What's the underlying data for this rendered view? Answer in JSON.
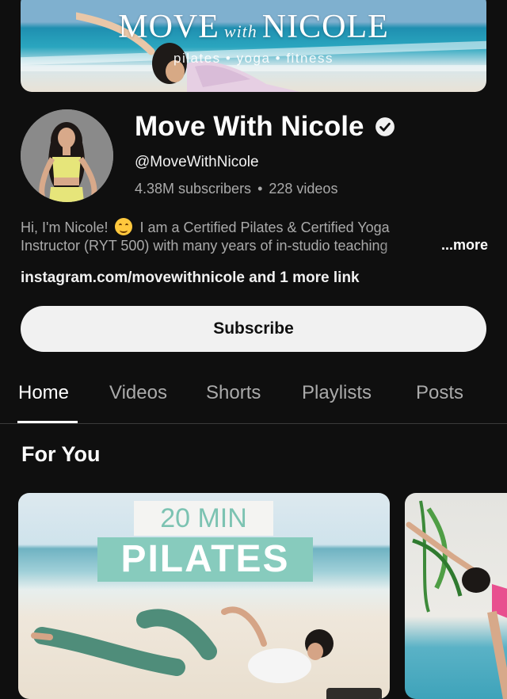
{
  "banner": {
    "title_left": "MOVE",
    "title_with": "with",
    "title_right": "NICOLE",
    "subtitle": "pilates • yoga • fitness"
  },
  "channel": {
    "name": "Move With Nicole",
    "handle": "@MoveWithNicole",
    "subscribers": "4.38M subscribers",
    "separator": "•",
    "videos": "228 videos",
    "description_line1_a": "Hi, I'm Nicole!",
    "description_line1_b": "I am a Certified Pilates & Certified Yoga",
    "description_line2": "Instructor (RYT 500) with many years of in-studio teaching",
    "more_label": "...more",
    "links": "instagram.com/movewithnicole and 1 more link",
    "subscribe_label": "Subscribe"
  },
  "tabs": [
    {
      "label": "Home",
      "active": true
    },
    {
      "label": "Videos",
      "active": false
    },
    {
      "label": "Shorts",
      "active": false
    },
    {
      "label": "Playlists",
      "active": false
    },
    {
      "label": "Posts",
      "active": false
    }
  ],
  "section": {
    "title": "For You"
  },
  "videos": [
    {
      "line1": "20 MIN",
      "line2": "PILATES"
    }
  ],
  "colors": {
    "background": "#0f0f0f",
    "subscribe_bg": "#f1f1f1",
    "accent_teal": "#87cbbd"
  },
  "icons": {
    "verified": "verified-check-icon"
  }
}
